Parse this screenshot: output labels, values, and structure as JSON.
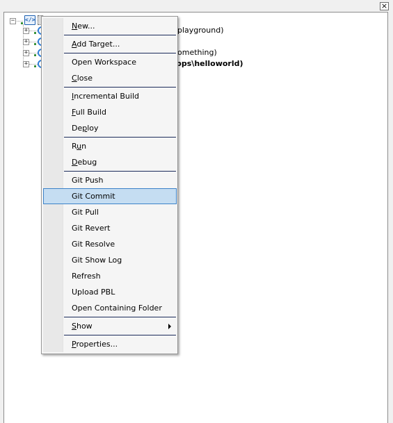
{
  "window": {
    "close_glyph": "×"
  },
  "tree": {
    "root_icon": "workspace-icon",
    "items": [
      {
        "label": "playground)",
        "bold": false,
        "icon": "target-icon",
        "expander": "+"
      },
      {
        "label": "",
        "bold": false,
        "icon": "target-icon",
        "expander": "+"
      },
      {
        "label": "omething)",
        "bold": false,
        "icon": "target-icon",
        "expander": "+"
      },
      {
        "label": "pps\\helloworld)",
        "bold": true,
        "icon": "target-icon",
        "expander": "+"
      }
    ],
    "root_expander": "−"
  },
  "context_menu": {
    "highlight_color": "#c5ddf2",
    "highlight_border": "#3c82c8",
    "items": [
      {
        "id": "new",
        "label": "New...",
        "underline": "N"
      },
      {
        "id": "add-target",
        "label": "Add Target...",
        "underline": "A"
      },
      {
        "id": "open-workspace",
        "label": "Open Workspace",
        "underline": ""
      },
      {
        "id": "close",
        "label": "Close",
        "underline": "C"
      },
      {
        "id": "incremental-build",
        "label": "Incremental Build",
        "underline": "I"
      },
      {
        "id": "full-build",
        "label": "Full Build",
        "underline": "F"
      },
      {
        "id": "deploy",
        "label": "Deploy",
        "underline": "p"
      },
      {
        "id": "run",
        "label": "Run",
        "underline": "u"
      },
      {
        "id": "debug",
        "label": "Debug",
        "underline": "D"
      },
      {
        "id": "git-push",
        "label": "Git Push",
        "underline": ""
      },
      {
        "id": "git-commit",
        "label": "Git Commit",
        "underline": "",
        "highlighted": true
      },
      {
        "id": "git-pull",
        "label": "Git Pull",
        "underline": ""
      },
      {
        "id": "git-revert",
        "label": "Git Revert",
        "underline": ""
      },
      {
        "id": "git-resolve",
        "label": "Git Resolve",
        "underline": ""
      },
      {
        "id": "git-show-log",
        "label": "Git Show Log",
        "underline": ""
      },
      {
        "id": "refresh",
        "label": "Refresh",
        "underline": ""
      },
      {
        "id": "upload-pbl",
        "label": "Upload PBL",
        "underline": ""
      },
      {
        "id": "open-containing-folder",
        "label": "Open Containing Folder",
        "underline": ""
      },
      {
        "id": "show",
        "label": "Show",
        "underline": "S",
        "submenu": true
      },
      {
        "id": "properties",
        "label": "Properties...",
        "underline": "P"
      }
    ]
  }
}
